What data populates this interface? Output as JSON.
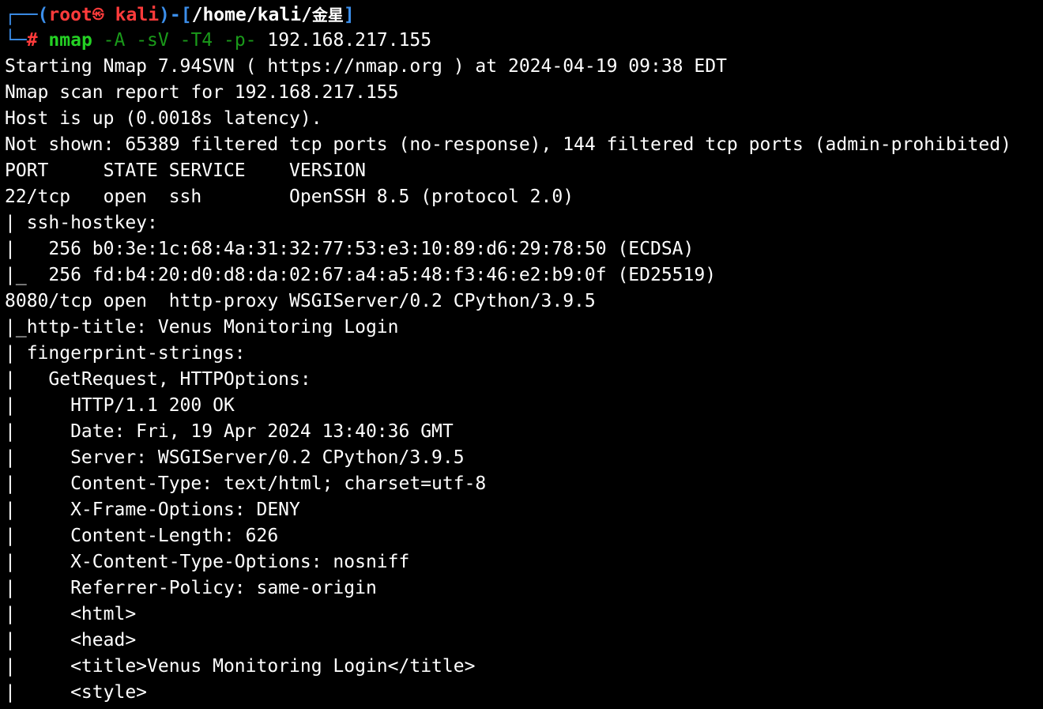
{
  "prompt": {
    "box_top": "┌──(",
    "user": "root",
    "skull": "㉿",
    "host": "kali",
    "mid": ")-[",
    "path": "/home/kali/",
    "path_cjk": "金星",
    "close": "]",
    "box_bottom": "└─",
    "hash": "#",
    "command": "nmap",
    "flags": "-A -sV -T4 -p-",
    "target": "192.168.217.155"
  },
  "output_lines": [
    "Starting Nmap 7.94SVN ( https://nmap.org ) at 2024-04-19 09:38 EDT",
    "Nmap scan report for 192.168.217.155",
    "Host is up (0.0018s latency).",
    "Not shown: 65389 filtered tcp ports (no-response), 144 filtered tcp ports (admin-prohibited)",
    "PORT     STATE SERVICE    VERSION",
    "22/tcp   open  ssh        OpenSSH 8.5 (protocol 2.0)",
    "| ssh-hostkey: ",
    "|   256 b0:3e:1c:68:4a:31:32:77:53:e3:10:89:d6:29:78:50 (ECDSA)",
    "|_  256 fd:b4:20:d0:d8:da:02:67:a4:a5:48:f3:46:e2:b9:0f (ED25519)",
    "8080/tcp open  http-proxy WSGIServer/0.2 CPython/3.9.5",
    "|_http-title: Venus Monitoring Login",
    "| fingerprint-strings: ",
    "|   GetRequest, HTTPOptions: ",
    "|     HTTP/1.1 200 OK",
    "|     Date: Fri, 19 Apr 2024 13:40:36 GMT",
    "|     Server: WSGIServer/0.2 CPython/3.9.5",
    "|     Content-Type: text/html; charset=utf-8",
    "|     X-Frame-Options: DENY",
    "|     Content-Length: 626",
    "|     X-Content-Type-Options: nosniff",
    "|     Referrer-Policy: same-origin",
    "|     <html>",
    "|     <head>",
    "|     <title>Venus Monitoring Login</title>",
    "|     <style>"
  ]
}
